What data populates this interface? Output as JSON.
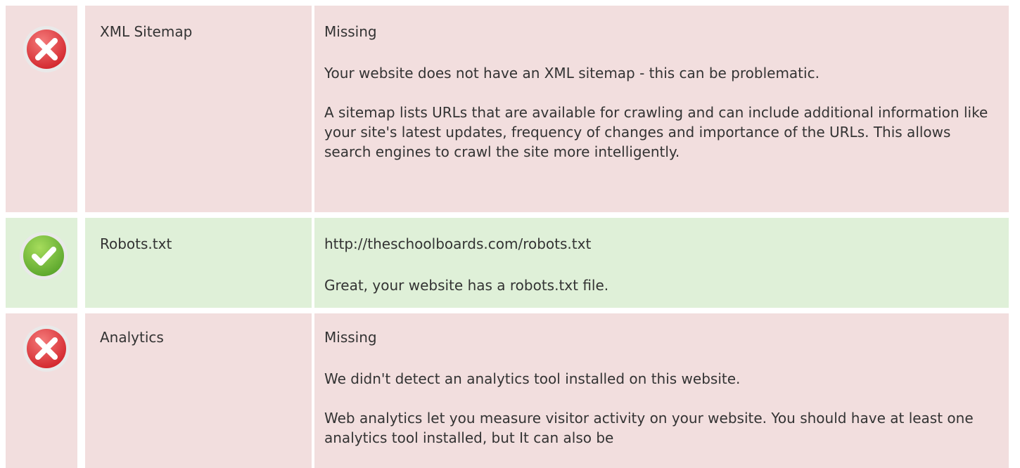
{
  "rows": [
    {
      "status": "fail",
      "status_icon": "error-x-icon",
      "label": "XML Sitemap",
      "value": "Missing",
      "summary": "Your website does not have an XML sitemap - this can be problematic.",
      "detail": "A sitemap lists URLs that are available for crawling and can include additional information like your site's latest updates, frequency of changes and importance of the URLs. This allows search engines to crawl the site more intelligently."
    },
    {
      "status": "pass",
      "status_icon": "check-icon",
      "label": "Robots.txt",
      "value": "http://theschoolboards.com/robots.txt",
      "summary": "Great, your website has a robots.txt file."
    },
    {
      "status": "fail",
      "status_icon": "error-x-icon",
      "label": "Analytics",
      "value": "Missing",
      "summary": "We didn't detect an analytics tool installed on this website.",
      "detail": "Web analytics let you measure visitor activity on your website. You should have at least one analytics tool installed, but It can also be"
    }
  ],
  "colors": {
    "fail_bg": "#f2dede",
    "pass_bg": "#dff0d8",
    "fail_icon": "#e0393e",
    "pass_icon": "#7cc242",
    "text": "#333333"
  }
}
